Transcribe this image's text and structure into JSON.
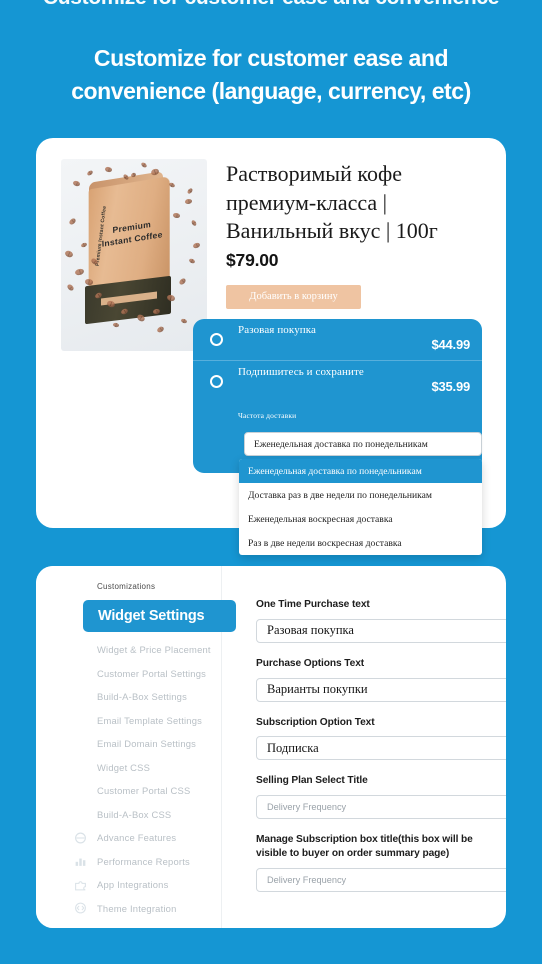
{
  "page": {
    "background_color": "#1596d3",
    "accent_color": "#1f95d0",
    "top_remnant_text": "Customize for customer ease and convenience",
    "headline_line1": "Customize for customer ease and",
    "headline_line2": "convenience (language, currency, etc)"
  },
  "product": {
    "title": "Растворимый кофе премиум-класса | Ванильный вкус | 100г",
    "price": "$79.00",
    "add_to_cart_label": "Добавить в корзину",
    "image_alt": "Premium Instant Coffee",
    "bag_text": "Premium Instant Coffee",
    "bag_side_text": "Premium Instant Coffee"
  },
  "subscription_widget": {
    "options": [
      {
        "label": "Разовая покупка",
        "price": "$44.99",
        "selected": false
      },
      {
        "label": "Подпишитесь и сохраните",
        "price": "$35.99",
        "selected": true
      }
    ],
    "frequency_label": "Частота доставки",
    "selected_frequency": "Еженедельная доставка по понедельникам",
    "frequency_options": [
      "Еженедельная доставка по понедельникам",
      "Доставка раз в две недели по понедельникам",
      "Еженедельная воскресная доставка",
      "Раз в две недели воскресная доставка"
    ]
  },
  "settings": {
    "sidebar": {
      "section_label": "Customizations",
      "active_item": "Widget Settings",
      "items": [
        {
          "label": "Widget & Price Placement",
          "icon": ""
        },
        {
          "label": "Customer Portal Settings",
          "icon": ""
        },
        {
          "label": "Build-A-Box Settings",
          "icon": ""
        },
        {
          "label": "Email Template Settings",
          "icon": ""
        },
        {
          "label": "Email Domain Settings",
          "icon": ""
        },
        {
          "label": "Widget CSS",
          "icon": ""
        },
        {
          "label": "Customer Portal CSS",
          "icon": ""
        },
        {
          "label": "Build-A-Box CSS",
          "icon": ""
        },
        {
          "label": "Advance Features",
          "icon": "sparkle-icon"
        },
        {
          "label": "Performance Reports",
          "icon": "chart-icon"
        },
        {
          "label": "App Integrations",
          "icon": "puzzle-icon"
        },
        {
          "label": "Theme Integration",
          "icon": "code-icon"
        }
      ]
    },
    "fields": [
      {
        "label": "One Time Purchase text",
        "value": "Разовая покупка",
        "placeholder": ""
      },
      {
        "label": "Purchase Options Text",
        "value": "Варианты покупки",
        "placeholder": ""
      },
      {
        "label": "Subscription Option Text",
        "value": "Подписка",
        "placeholder": ""
      },
      {
        "label": "Selling Plan Select Title",
        "value": "",
        "placeholder": "Delivery Frequency"
      },
      {
        "label": "Manage Subscription box title(this box will be visible to buyer on order summary page)",
        "value": "",
        "placeholder": "Delivery Frequency"
      }
    ]
  }
}
